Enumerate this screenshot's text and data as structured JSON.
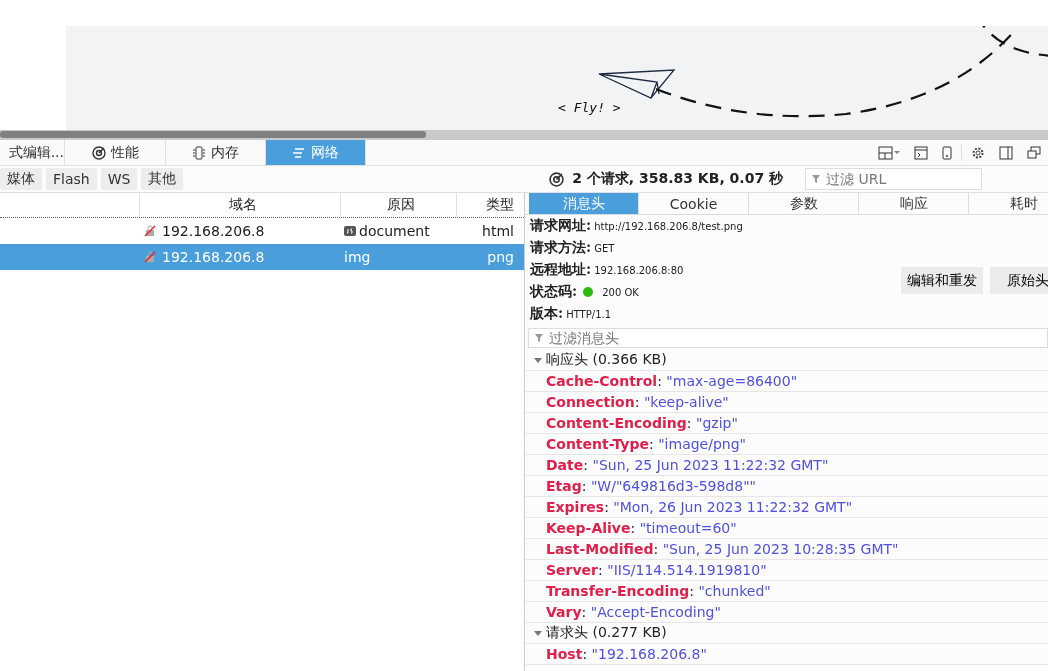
{
  "page": {
    "fly_label": "< Fly! >"
  },
  "toolbar": {
    "tabs": [
      {
        "label": "式编辑...",
        "kind": "plain",
        "selected": false
      },
      {
        "label": "性能",
        "kind": "gauge",
        "selected": false
      },
      {
        "label": "内存",
        "kind": "memory",
        "selected": false
      },
      {
        "label": "网络",
        "kind": "network",
        "selected": true
      }
    ]
  },
  "filters": [
    "媒体",
    "Flash",
    "WS",
    "其他"
  ],
  "summary": "2 个请求, 358.83 KB, 0.07 秒",
  "url_filter": {
    "placeholder": "过滤 URL"
  },
  "requests": {
    "columns": [
      "域名",
      "原因",
      "类型"
    ],
    "rows": [
      {
        "domain": "192.168.206.8",
        "cause": "document",
        "js_badge": true,
        "type": "html",
        "selected": false
      },
      {
        "domain": "192.168.206.8",
        "cause": "img",
        "js_badge": false,
        "type": "png",
        "selected": true
      }
    ]
  },
  "details": {
    "tabs": [
      {
        "label": "消息头",
        "selected": true
      },
      {
        "label": "Cookie",
        "selected": false
      },
      {
        "label": "参数",
        "selected": false
      },
      {
        "label": "响应",
        "selected": false
      },
      {
        "label": "耗时",
        "selected": false
      }
    ],
    "fields": [
      {
        "label": "请求网址:",
        "value": "http://192.168.206.8/test.png",
        "kind": "text"
      },
      {
        "label": "请求方法:",
        "value": "GET",
        "kind": "text"
      },
      {
        "label": "远程地址:",
        "value": "192.168.206.8:80",
        "kind": "text"
      },
      {
        "label": "状态码:",
        "value": "200  OK",
        "kind": "status",
        "color": "#2cbb0f"
      },
      {
        "label": "版本:",
        "value": "HTTP/1.1",
        "kind": "text"
      }
    ],
    "buttons": [
      "编辑和重发",
      "原始头"
    ],
    "header_filter": {
      "placeholder": "过滤消息头"
    },
    "sections": [
      {
        "title": "响应头 (0.366 KB)",
        "expanded": true,
        "headers": [
          {
            "name": "Cache-Control",
            "sep": ":",
            "value": "\"max-age=86400\""
          },
          {
            "name": "Connection",
            "sep": ":",
            "value": "\"keep-alive\""
          },
          {
            "name": "Content-Encoding",
            "sep": ":",
            "value": "\"gzip\""
          },
          {
            "name": "Content-Type",
            "sep": ":",
            "value": "\"image/png\""
          },
          {
            "name": "Date",
            "sep": ":",
            "value": "\"Sun, 25 Jun 2023 11:22:32 GMT\""
          },
          {
            "name": "Etag",
            "sep": ":",
            "value": "\"W/\"649816d3-598d8\"\""
          },
          {
            "name": "Expires",
            "sep": ":",
            "value": "\"Mon, 26 Jun 2023 11:22:32 GMT\""
          },
          {
            "name": "Keep-Alive",
            "sep": ":",
            "value": "\"timeout=60\""
          },
          {
            "name": "Last-Modified",
            "sep": ":",
            "value": "\"Sun, 25 Jun 2023 10:28:35 GMT\""
          },
          {
            "name": "Server",
            "sep": ":",
            "value": "\"IIS/114.514.1919810\""
          },
          {
            "name": "Transfer-Encoding",
            "sep": ":",
            "value": "\"chunked\""
          },
          {
            "name": "Vary",
            "sep": ":",
            "value": "\"Accept-Encoding\""
          }
        ]
      },
      {
        "title": "请求头 (0.277 KB)",
        "expanded": true,
        "headers": [
          {
            "name": "Host",
            "sep": ":",
            "value": "\"192.168.206.8\""
          }
        ]
      }
    ]
  }
}
